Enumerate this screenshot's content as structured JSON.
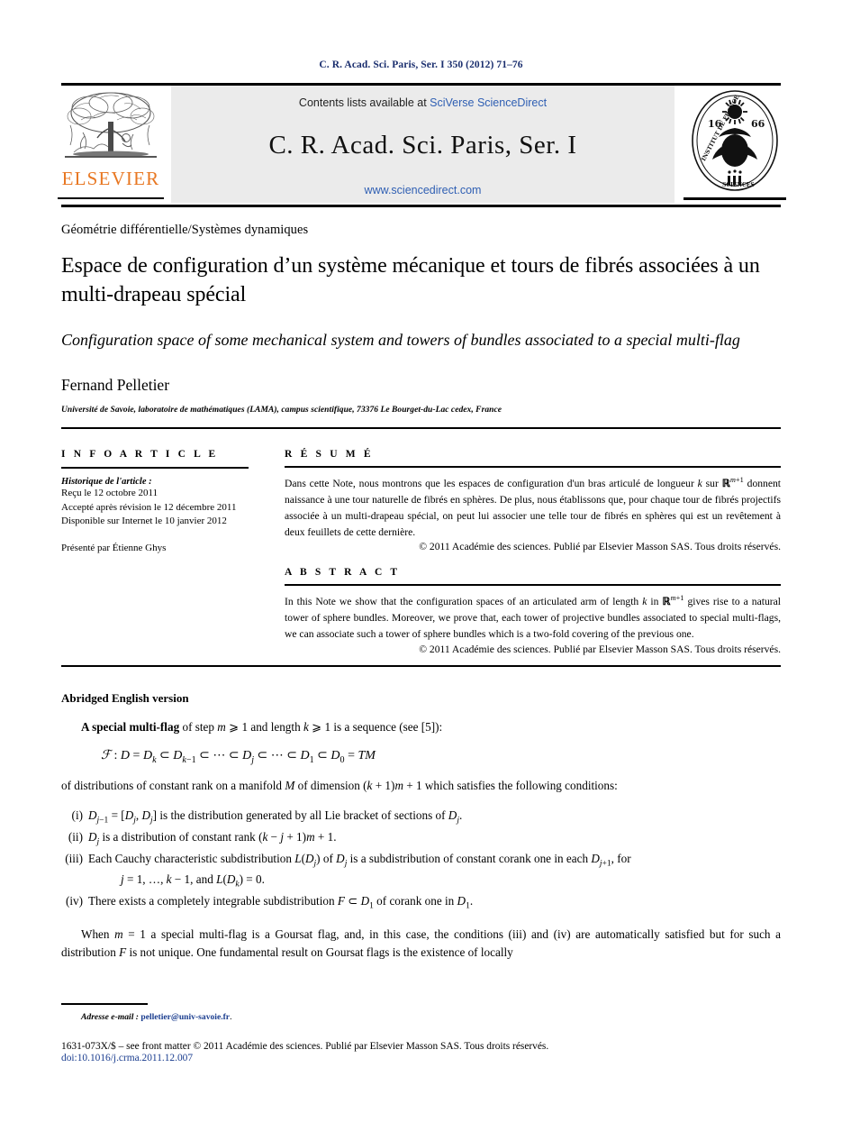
{
  "running_head": "C. R. Acad. Sci. Paris, Ser. I 350 (2012) 71–76",
  "masthead": {
    "contents_prefix": "Contents lists available at ",
    "contents_link": "SciVerse ScienceDirect",
    "journal_title": "C. R. Acad. Sci. Paris, Ser. I",
    "sciencedirect_url": "www.sciencedirect.com",
    "publisher_logo_text": "ELSEVIER",
    "publisher_logo_color": "#E87722",
    "seal_text_top": "INSTITUT DE FRANCE",
    "seal_text_bottom": "ACADEMIE DES SCIENCES",
    "seal_year": "1666",
    "link_color": "#2f5fb3"
  },
  "article": {
    "subject": "Géométrie différentielle/Systèmes dynamiques",
    "title_fr": "Espace de configuration d’un système mécanique et tours de fibrés associées à un multi-drapeau spécial",
    "title_en": "Configuration space of some mechanical system and towers of bundles associated to a special multi-flag",
    "author": "Fernand Pelletier",
    "affiliation": "Université de Savoie, laboratoire de mathématiques (LAMA), campus scientifique, 73376 Le Bourget-du-Lac cedex, France"
  },
  "info": {
    "heading": "I N F O   A R T I C L E",
    "history_label": "Historique de l'article :",
    "history": [
      "Reçu le 12 octobre 2011",
      "Accepté après révision le 12 décembre 2011",
      "Disponible sur Internet le 10 janvier 2012"
    ],
    "presented_by": "Présenté par Étienne Ghys"
  },
  "resume": {
    "heading": "R É S U M É",
    "body": "Dans cette Note, nous montrons que les espaces de configuration d'un bras articulé de longueur k sur ℝ^{m+1} donnent naissance à une tour naturelle de fibrés en sphères. De plus, nous établissons que, pour chaque tour de fibrés projectifs associée à un multi-drapeau spécial, on peut lui associer une telle tour de fibrés en sphères qui est un revêtement à deux feuillets de cette dernière.",
    "copyright": "© 2011 Académie des sciences. Publié par Elsevier Masson SAS. Tous droits réservés."
  },
  "abstract": {
    "heading": "A B S T R A C T",
    "body": "In this Note we show that the configuration spaces of an articulated arm of length k in ℝ^{m+1} gives rise to a natural tower of sphere bundles. Moreover, we prove that, each tower of projective bundles associated to special multi-flags, we can associate such a tower of sphere bundles which is a two-fold covering of the previous one.",
    "copyright": "© 2011 Académie des sciences. Publié par Elsevier Masson SAS. Tous droits réservés."
  },
  "body_section": {
    "heading": "Abridged English version",
    "para1_bold": "A special multi-flag",
    "para1_rest": " of step m ⩾ 1 and length k ⩾ 1 is a sequence (see [5]):",
    "formula": "ℱ : D = D_k ⊂ D_{k−1} ⊂ ⋯ ⊂ D_j ⊂ ⋯ ⊂ D_1 ⊂ D_0 = TM",
    "para2": "of distributions of constant rank on a manifold M of dimension (k + 1)m + 1 which satisfies the following conditions:",
    "conditions": [
      {
        "num": "(i)",
        "text": "D_{j−1} = [D_j, D_j] is the distribution generated by all Lie bracket of sections of D_j."
      },
      {
        "num": "(ii)",
        "text": "D_j is a distribution of constant rank (k − j + 1)m + 1."
      },
      {
        "num": "(iii)",
        "text": "Each Cauchy characteristic subdistribution L(D_j) of D_j is a subdistribution of constant corank one in each D_{j+1}, for",
        "cont": "j = 1, …, k − 1, and L(D_k) = 0."
      },
      {
        "num": "(iv)",
        "text": "There exists a completely integrable subdistribution F ⊂ D_1 of corank one in D_1."
      }
    ],
    "para3": "When m = 1 a special multi-flag is a Goursat flag, and, in this case, the conditions (iii) and (iv) are automatically satisfied but for such a distribution F is not unique. One fundamental result on Goursat flags is the existence of locally"
  },
  "footer": {
    "email_label": "Adresse e-mail :",
    "email": "pelletier@univ-savoie.fr",
    "email_suffix": ".",
    "front_matter": "1631-073X/$ – see front matter © 2011 Académie des sciences. Publié par Elsevier Masson SAS. Tous droits réservés.",
    "doi": "doi:10.1016/j.crma.2011.12.007",
    "link_color": "#1a3d8f"
  }
}
